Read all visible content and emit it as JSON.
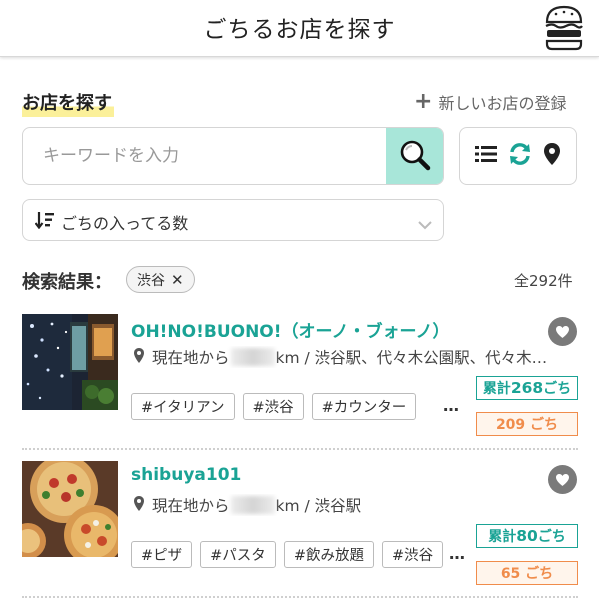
{
  "header": {
    "title": "ごちるお店を探す",
    "menu_icon": "hamburger-burger-icon"
  },
  "search_section": {
    "title": "お店を探す",
    "register_label": "新しいお店の登録",
    "search": {
      "placeholder": "キーワードを入力",
      "value": ""
    },
    "sort": {
      "label": "ごちの入ってる数"
    },
    "accent_color": "#a8e6d9",
    "view_icons": [
      "list-icon",
      "refresh-icon",
      "map-pin-icon"
    ]
  },
  "results": {
    "label": "検索結果：",
    "filter_chip": "渋谷",
    "count": "全292件"
  },
  "shops": [
    {
      "name": "OH!NO!BUONO!（オーノ・ブォーノ）",
      "loc_prefix": "現在地から",
      "loc_suffix": "km / 渋谷駅、代々木公園駅、代々木…",
      "tags": [
        "#イタリアン",
        "#渋谷",
        "#カウンター"
      ],
      "more": "…",
      "total_prefix": "累計",
      "total_value": "268",
      "total_suffix": "ごち",
      "today": "209 ごち"
    },
    {
      "name": "shibuya101",
      "loc_prefix": "現在地から",
      "loc_suffix": "km / 渋谷駅",
      "tags": [
        "#ピザ",
        "#パスタ",
        "#飲み放題",
        "#渋谷"
      ],
      "more": "…",
      "total_prefix": "累計",
      "total_value": "80",
      "total_suffix": "ごち",
      "today": "65 ごち"
    }
  ]
}
